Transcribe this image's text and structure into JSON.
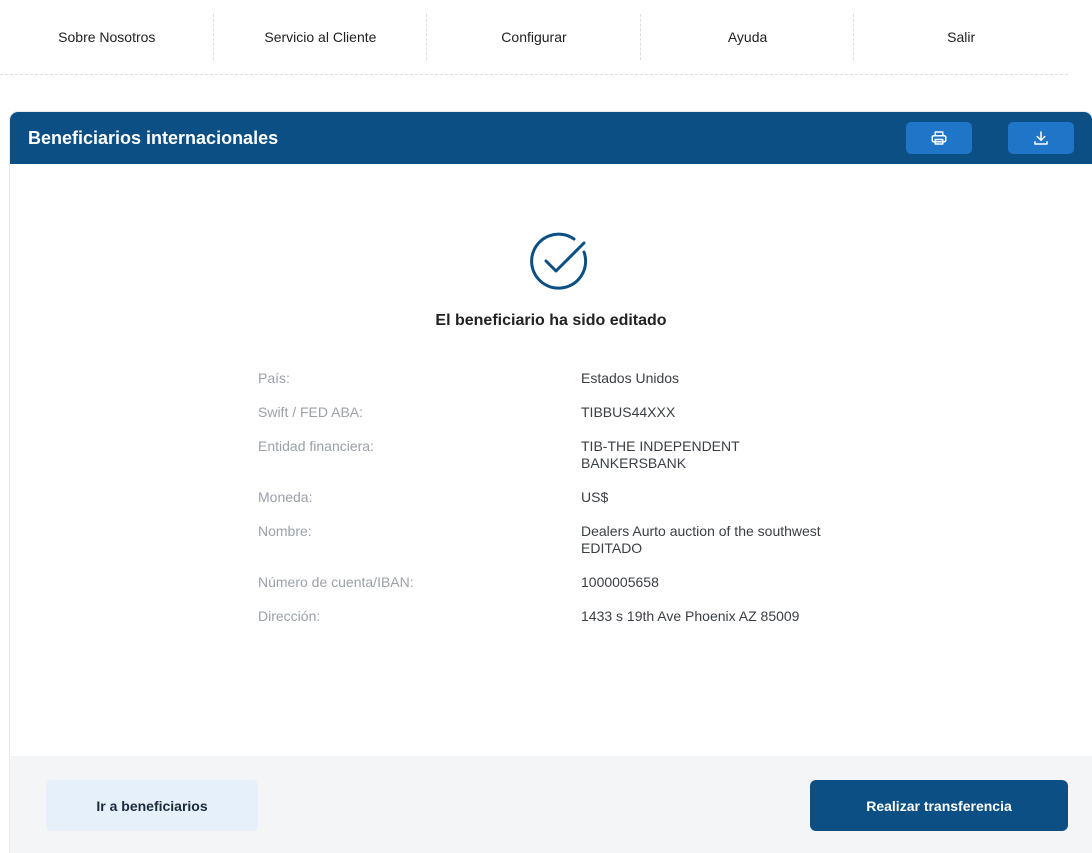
{
  "nav": {
    "items": [
      {
        "label": "Sobre Nosotros"
      },
      {
        "label": "Servicio al Cliente"
      },
      {
        "label": "Configurar"
      },
      {
        "label": "Ayuda"
      },
      {
        "label": "Salir"
      }
    ]
  },
  "card": {
    "title": "Beneficiarios internacionales",
    "actions": {
      "print_icon": "printer-icon",
      "download_icon": "download-icon"
    },
    "success_icon": "check-circle-icon",
    "success_message": "El beneficiario ha sido editado",
    "details": [
      {
        "label": "País:",
        "value": "Estados Unidos"
      },
      {
        "label": "Swift / FED ABA:",
        "value": "TIBBUS44XXX"
      },
      {
        "label": "Entidad financiera:",
        "value": "TIB-THE INDEPENDENT BANKERSBANK"
      },
      {
        "label": "Moneda:",
        "value": "US$"
      },
      {
        "label": "Nombre:",
        "value": "Dealers Aurto auction of the southwest EDITADO"
      },
      {
        "label": "Número de cuenta/IBAN:",
        "value": "1000005658"
      },
      {
        "label": "Dirección:",
        "value": "1433 s 19th Ave Phoenix AZ 85009"
      }
    ]
  },
  "footer": {
    "secondary_label": "Ir a beneficiarios",
    "primary_label": "Realizar transferencia"
  },
  "colors": {
    "brand": "#0b4f85",
    "header_button": "#1f75c7",
    "secondary_button": "#e6f0fa",
    "footer_bg": "#f4f5f6"
  }
}
